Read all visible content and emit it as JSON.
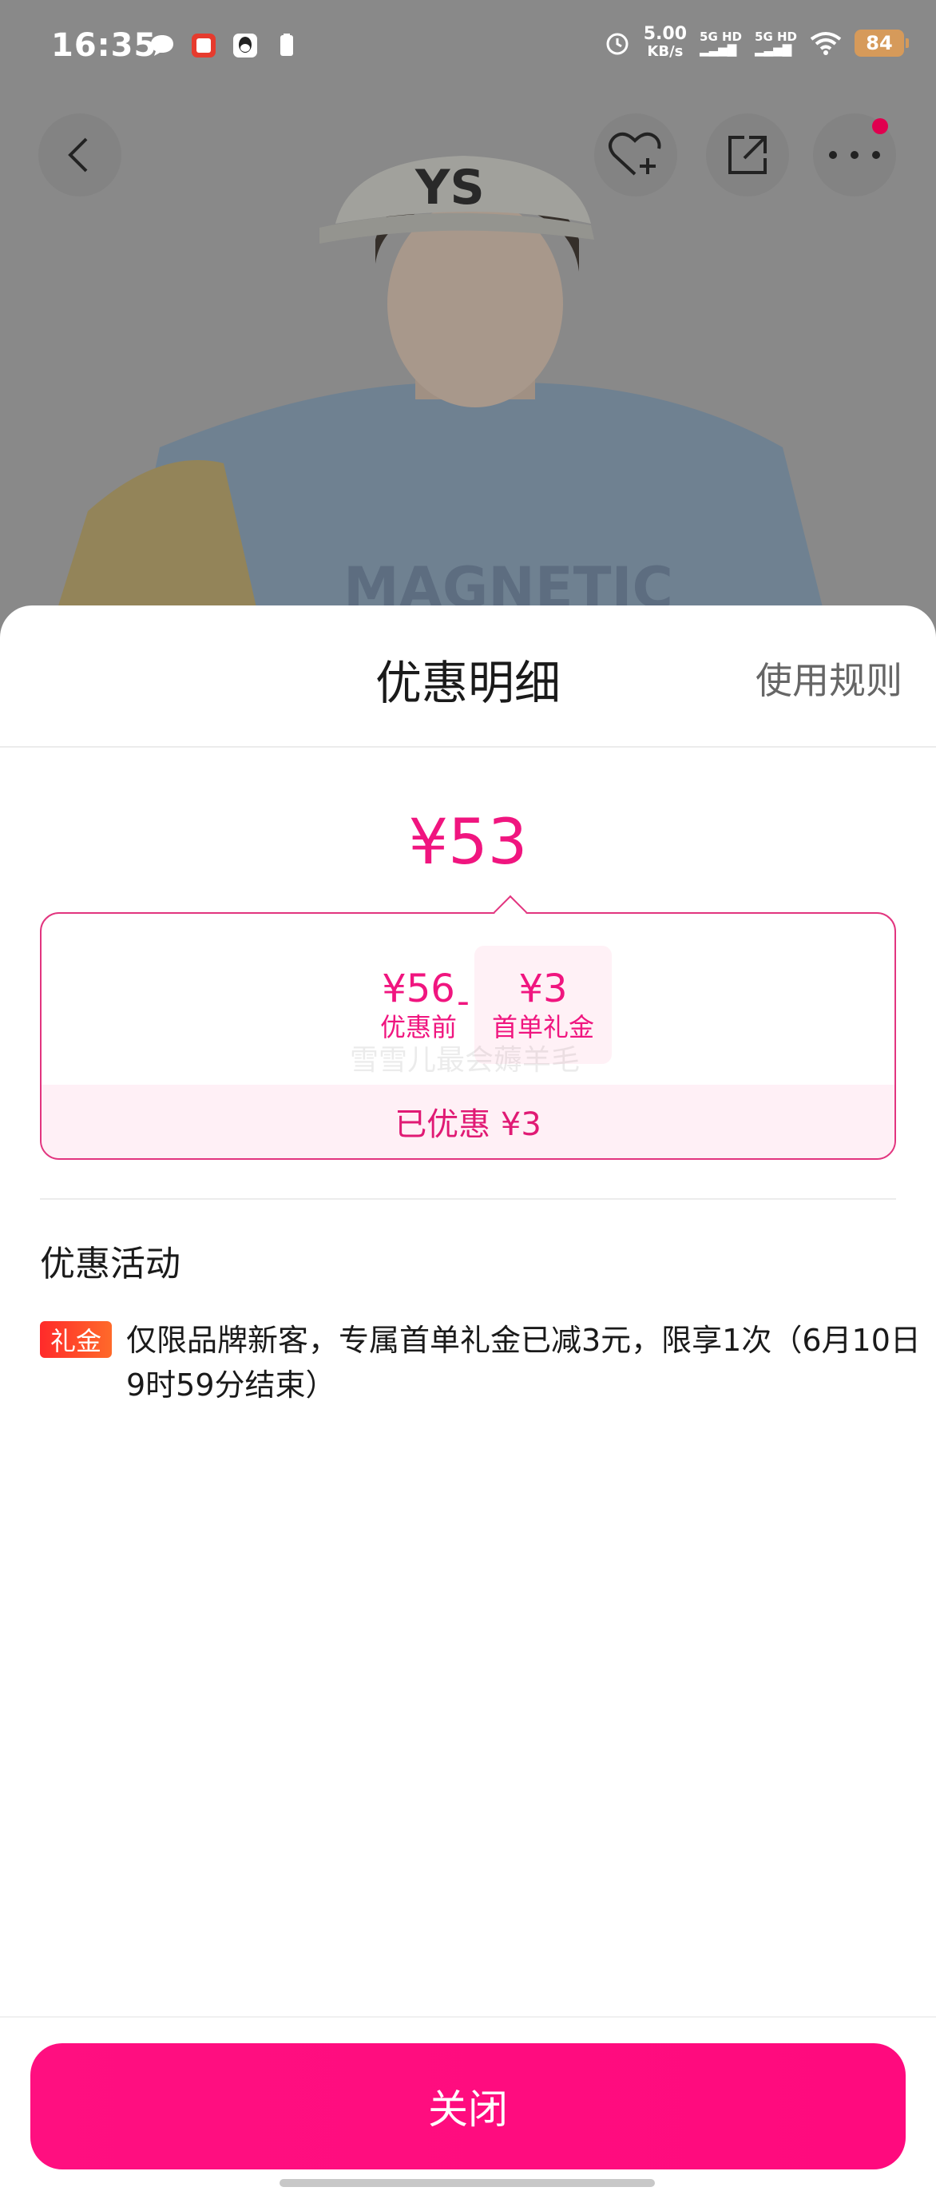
{
  "status_bar": {
    "time": "16:35",
    "net_speed_value": "5.00",
    "net_speed_unit": "KB/s",
    "signal_1": "5G HD",
    "signal_2": "5G HD",
    "battery": "84",
    "icons": [
      "message-icon",
      "app-icon",
      "qq-icon",
      "battery-saver-icon",
      "alarm-icon",
      "wifi-icon"
    ]
  },
  "nav": {
    "back_icon": "back-arrow-icon",
    "favorite_icon": "heart-add-icon",
    "share_icon": "share-icon",
    "more_icon": "more-icon"
  },
  "sheet": {
    "title": "优惠明细",
    "rules_link": "使用规则",
    "final_price": "¥53",
    "breakdown": {
      "original_amount": "¥56",
      "original_label": "优惠前",
      "operator": "-",
      "coupon_amount": "¥3",
      "coupon_label": "首单礼金",
      "watermark": "雪雪儿最会薅羊毛",
      "saved_text": "已优惠 ¥3"
    },
    "activity": {
      "section_title": "优惠活动",
      "tag": "礼金",
      "description": "仅限品牌新客，专属首单礼金已减3元，限享1次（6月10日9时59分结束）"
    },
    "close_button": "关闭"
  },
  "colors": {
    "accent": "#f0157f",
    "button": "#ff0f80",
    "tag_red": "#ff2a2a"
  }
}
